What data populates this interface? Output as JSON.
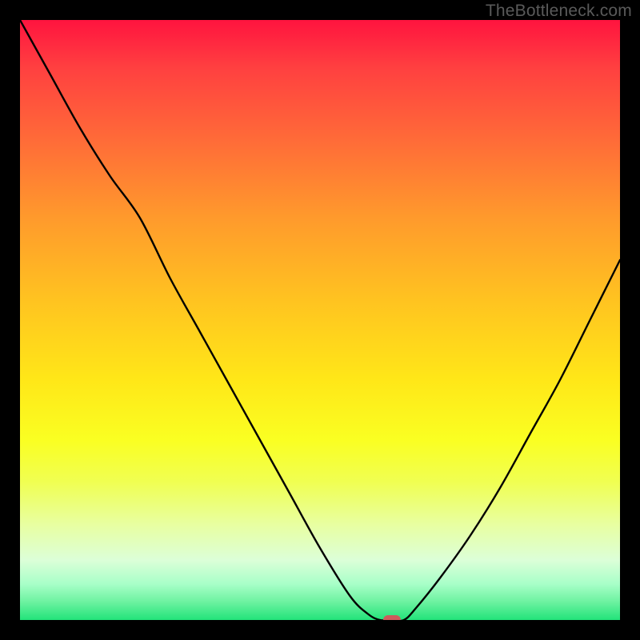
{
  "watermark": "TheBottleneck.com",
  "colors": {
    "background": "#000000",
    "curve_stroke": "#000000",
    "marker_fill": "#cd5c5c",
    "gradient_top": "#ff143f",
    "gradient_bottom": "#22e37a"
  },
  "chart_data": {
    "type": "line",
    "title": "",
    "xlabel": "",
    "ylabel": "",
    "xlim": [
      0,
      100
    ],
    "ylim": [
      0,
      100
    ],
    "note": "Background gradient encodes bottleneck severity (top = 100% bad / red, bottom = 0% good / green). The black curve is the bottleneck percentage vs. an implicit x-axis; it dips to 0 near x≈62 then rises. y=0 corresponds to the bottom of the plot, y=100 to the top.",
    "series": [
      {
        "name": "bottleneck-curve",
        "x": [
          0,
          5,
          10,
          15,
          20,
          25,
          30,
          35,
          40,
          45,
          50,
          55,
          58,
          60,
          62,
          64,
          66,
          70,
          75,
          80,
          85,
          90,
          95,
          100
        ],
        "y": [
          100,
          91,
          82,
          74,
          67,
          57,
          48,
          39,
          30,
          21,
          12,
          4,
          1,
          0,
          0,
          0,
          2,
          7,
          14,
          22,
          31,
          40,
          50,
          60
        ]
      }
    ],
    "marker": {
      "x": 62,
      "y": 0,
      "label": "optimal-point"
    }
  }
}
